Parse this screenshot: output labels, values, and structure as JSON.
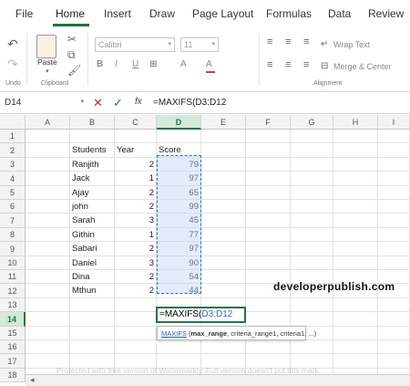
{
  "ribbon_tabs": [
    "File",
    "Home",
    "Insert",
    "Draw",
    "Page Layout",
    "Formulas",
    "Data",
    "Review"
  ],
  "active_tab": "Home",
  "ribbon": {
    "undo_label": "Undo",
    "clipboard_label": "Clipboard",
    "paste_label": "Paste",
    "font_name": "Calibri",
    "font_size": "11",
    "bold": "B",
    "italic": "I",
    "underline": "U",
    "font_grow": "A",
    "font_shrink": "A",
    "fill_color": "A",
    "wrap_text": "Wrap Text",
    "merge_center": "Merge & Center",
    "alignment_label": "Alignment"
  },
  "formula_bar": {
    "name_box": "D14",
    "fx": "fx",
    "content": "=MAXIFS(D3:D12",
    "cancel_icon": "✕",
    "enter_icon": "✓"
  },
  "columns": [
    "A",
    "B",
    "C",
    "D",
    "E",
    "F",
    "G",
    "H",
    "I"
  ],
  "selected_column": "D",
  "rows": [
    "1",
    "2",
    "3",
    "4",
    "5",
    "6",
    "7",
    "8",
    "9",
    "10",
    "11",
    "12",
    "13",
    "14",
    "15",
    "16",
    "17",
    "18"
  ],
  "selected_row": "14",
  "headers": {
    "students": "Students",
    "year": "Year",
    "score": "Score"
  },
  "table": [
    {
      "student": "Ranjith",
      "year": "2",
      "score": "79"
    },
    {
      "student": "Jack",
      "year": "1",
      "score": "97"
    },
    {
      "student": "Ajay",
      "year": "2",
      "score": "65"
    },
    {
      "student": "john",
      "year": "2",
      "score": "99"
    },
    {
      "student": "Sarah",
      "year": "3",
      "score": "45"
    },
    {
      "student": "Githin",
      "year": "1",
      "score": "77"
    },
    {
      "student": "Sabari",
      "year": "2",
      "score": "97"
    },
    {
      "student": "Daniel",
      "year": "3",
      "score": "90"
    },
    {
      "student": "Dina",
      "year": "2",
      "score": "54"
    },
    {
      "student": "Mthun",
      "year": "2",
      "score": "44"
    }
  ],
  "active_cell": {
    "prefix": "=MAXIFS(",
    "ref": "D3:D12"
  },
  "tooltip": {
    "fn": "MAXIFS",
    "open": " (",
    "arg1": "max_range",
    "rest": ", criteria_range1, criteria1, ...)"
  },
  "watermark_logo": "developerpublish.com",
  "watermark_text": "Protected with free version of Watermarkly. Full version doesn't put this mark.",
  "colors": {
    "accent": "#217346",
    "selection": "#3a6fb5"
  }
}
